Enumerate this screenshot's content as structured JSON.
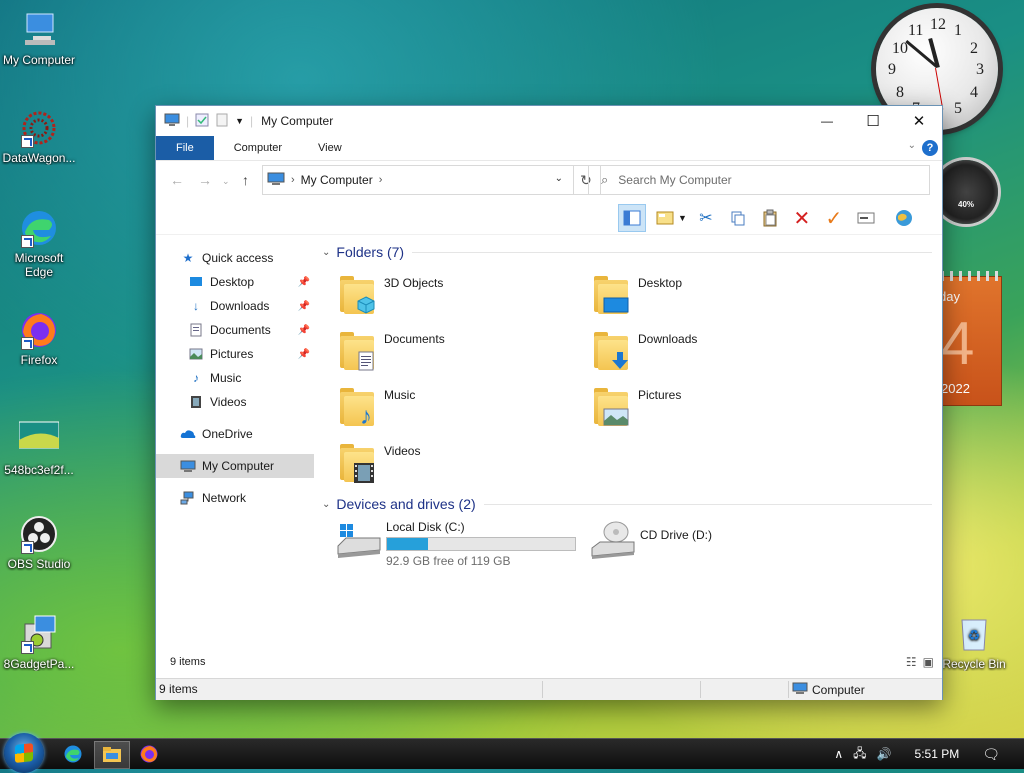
{
  "desktop": {
    "icons": [
      {
        "label": "My Computer"
      },
      {
        "label": "DataWagon..."
      },
      {
        "label": "Microsoft Edge"
      },
      {
        "label": "Firefox"
      },
      {
        "label": "548bc3ef2f..."
      },
      {
        "label": "OBS Studio"
      },
      {
        "label": "8GadgetPa..."
      },
      {
        "label": "Recycle Bin"
      }
    ],
    "gadgets": {
      "meter_percent": "40%",
      "calendar_day": "day",
      "calendar_number": "4",
      "calendar_year": "2022"
    }
  },
  "window": {
    "title": "My Computer",
    "controls": {
      "minimize": "—",
      "maximize": "☐",
      "close": "✕"
    },
    "ribbon_tabs": [
      "File",
      "Computer",
      "View"
    ],
    "help": "?",
    "address": {
      "crumb": "My Computer"
    },
    "search": {
      "placeholder": "Search My Computer"
    },
    "sidebar": [
      {
        "label": "Quick access",
        "icon": "star-icon"
      },
      {
        "label": "Desktop",
        "icon": "desktop-icon",
        "pinned": true
      },
      {
        "label": "Downloads",
        "icon": "download-icon",
        "pinned": true
      },
      {
        "label": "Documents",
        "icon": "document-icon",
        "pinned": true
      },
      {
        "label": "Pictures",
        "icon": "picture-icon",
        "pinned": true
      },
      {
        "label": "Music",
        "icon": "music-icon"
      },
      {
        "label": "Videos",
        "icon": "video-icon"
      },
      {
        "label": "OneDrive",
        "icon": "cloud-icon"
      },
      {
        "label": "My Computer",
        "icon": "computer-icon",
        "selected": true
      },
      {
        "label": "Network",
        "icon": "network-icon"
      }
    ],
    "folders_header": "Folders (7)",
    "folders": [
      {
        "name": "3D Objects",
        "badge": "cube-icon"
      },
      {
        "name": "Desktop",
        "badge": "desktop-icon"
      },
      {
        "name": "Documents",
        "badge": "document-icon"
      },
      {
        "name": "Downloads",
        "badge": "download-icon"
      },
      {
        "name": "Music",
        "badge": "music-icon"
      },
      {
        "name": "Pictures",
        "badge": "picture-icon"
      },
      {
        "name": "Videos",
        "badge": "video-icon"
      }
    ],
    "drives_header": "Devices and drives (2)",
    "drives": [
      {
        "name": "Local Disk (C:)",
        "free_text": "92.9 GB free of 119 GB",
        "used_fraction": 0.22
      },
      {
        "name": "CD Drive (D:)"
      }
    ],
    "item_count": "9 items",
    "statusbar": {
      "left": "9 items",
      "right": "Computer"
    }
  },
  "taskbar": {
    "time": "5:51 PM"
  },
  "colors": {
    "accent": "#1b5da6",
    "header_blue": "#1e3287",
    "bar_fill": "#26a0da"
  }
}
